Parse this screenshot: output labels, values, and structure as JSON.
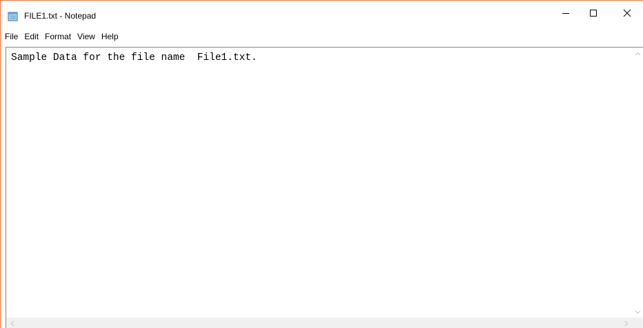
{
  "window": {
    "title": "FILE1.txt - Notepad",
    "accent_border_color": "#e8743b",
    "controls": {
      "minimize_icon": "minimize-icon",
      "maximize_icon": "maximize-icon",
      "close_icon": "close-icon"
    }
  },
  "menu": {
    "items": [
      {
        "label": "File"
      },
      {
        "label": "Edit"
      },
      {
        "label": "Format"
      },
      {
        "label": "View"
      },
      {
        "label": "Help"
      }
    ]
  },
  "editor": {
    "content": "Sample Data for the file name  File1.txt."
  }
}
